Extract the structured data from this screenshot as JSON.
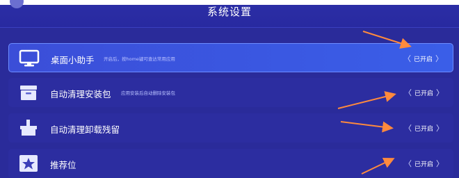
{
  "header": {
    "title": "系统设置"
  },
  "settings": [
    {
      "label": "桌面小助手",
      "description": "开启后，按home键可查达常用应用",
      "status": "已开启",
      "icon": "monitor-icon"
    },
    {
      "label": "自动清理安装包",
      "description": "应用安装后自动删除安装包",
      "status": "已开启",
      "icon": "package-box-icon"
    },
    {
      "label": "自动清理卸载残留",
      "description": "",
      "status": "已开启",
      "icon": "cleanup-icon"
    },
    {
      "label": "推荐位",
      "description": "",
      "status": "已开启",
      "icon": "star-icon"
    }
  ],
  "colors": {
    "background": "#2a2b9a",
    "active_row": "#3a5ee8",
    "annotation_arrow": "#ff8a3d"
  }
}
